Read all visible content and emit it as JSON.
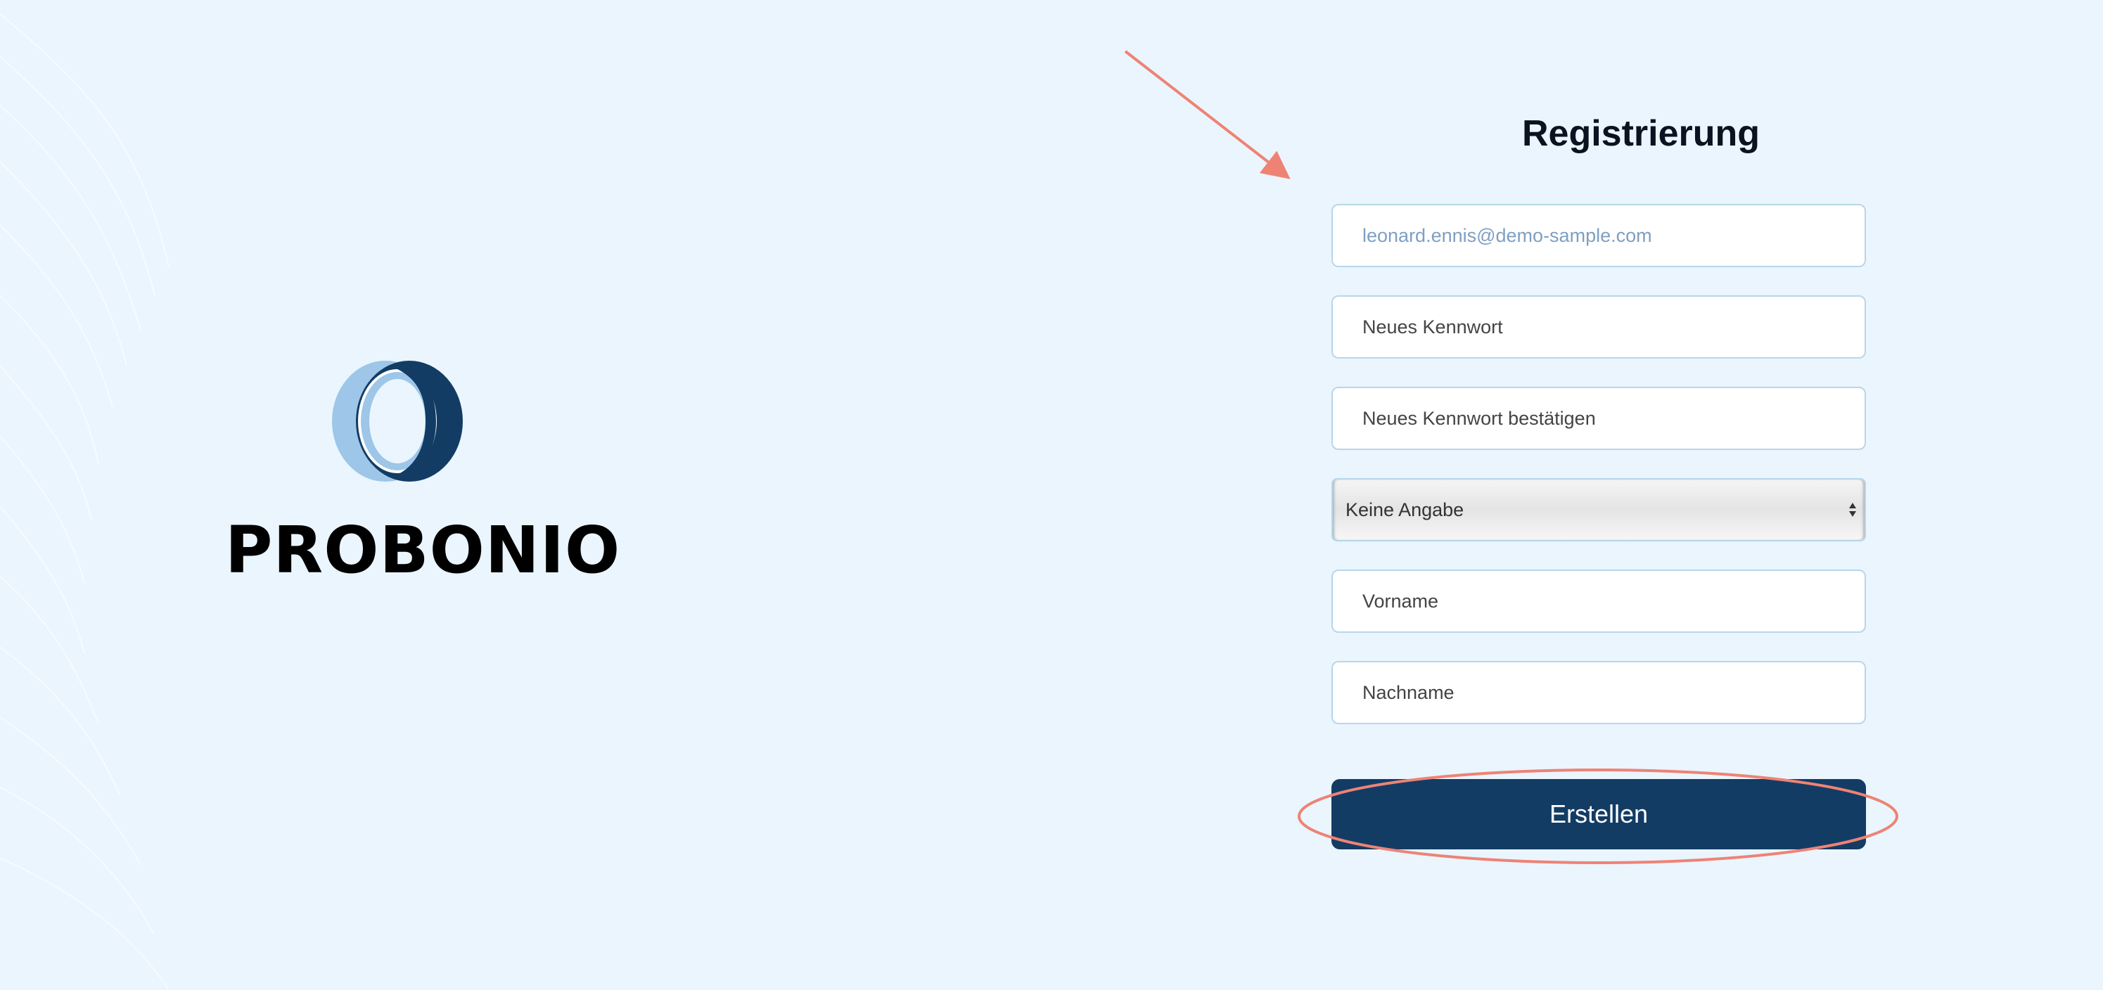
{
  "brand": {
    "name": "PROBONIO",
    "colors": {
      "logo_light": "#9dc6e8",
      "logo_dark": "#133c64"
    }
  },
  "form": {
    "title": "Registrierung",
    "email_value": "leonard.ennis@demo-sample.com",
    "password_placeholder": "Neues Kennwort",
    "password_confirm_placeholder": "Neues Kennwort bestätigen",
    "salutation_selected": "Keine Angabe",
    "firstname_placeholder": "Vorname",
    "lastname_placeholder": "Nachname",
    "submit_label": "Erstellen"
  },
  "colors": {
    "background": "#eaf5fe",
    "primary_button": "#133c64",
    "annotation": "#ee8375",
    "field_border": "#b8d6ea"
  }
}
